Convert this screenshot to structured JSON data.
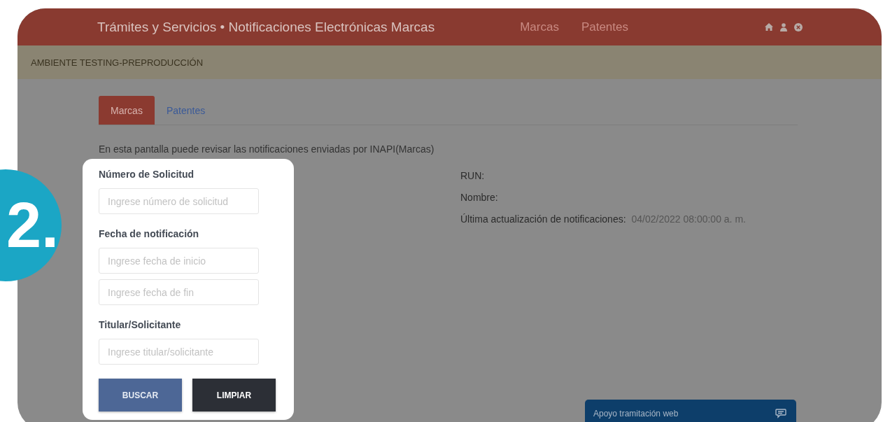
{
  "header": {
    "title": "Trámites y Servicios • Notificaciones Electrónicas Marcas",
    "nav": [
      "Marcas",
      "Patentes"
    ]
  },
  "environment_banner": "AMBIENTE TESTING-PREPRODUCCIÓN",
  "tabs": [
    {
      "label": "Marcas",
      "selected": true
    },
    {
      "label": "Patentes",
      "selected": false
    }
  ],
  "description": "En esta pantalla puede revisar las notificaciones enviadas por INAPI(Marcas)",
  "form": {
    "sections": [
      {
        "label": "Número de Solicitud",
        "fields": [
          {
            "placeholder": "Ingrese número de solicitud"
          }
        ]
      },
      {
        "label": "Fecha de notificación",
        "fields": [
          {
            "placeholder": "Ingrese fecha de inicio"
          },
          {
            "placeholder": "Ingrese fecha de fin"
          }
        ]
      },
      {
        "label": "Titular/Solicitante",
        "fields": [
          {
            "placeholder": "Ingrese titular/solicitante"
          }
        ]
      }
    ],
    "buttons": [
      {
        "label": "BUSCAR",
        "kind": "primary"
      },
      {
        "label": "LIMPIAR",
        "kind": "dark"
      }
    ]
  },
  "info": [
    {
      "label": "RUN:"
    },
    {
      "label": "Nombre:"
    },
    {
      "label": "Última actualización de notificaciones:",
      "value": "04/02/2022 08:00:00 a. m."
    }
  ],
  "help_widget": {
    "label": "Apoyo tramitación web"
  },
  "step_badge": "2."
}
